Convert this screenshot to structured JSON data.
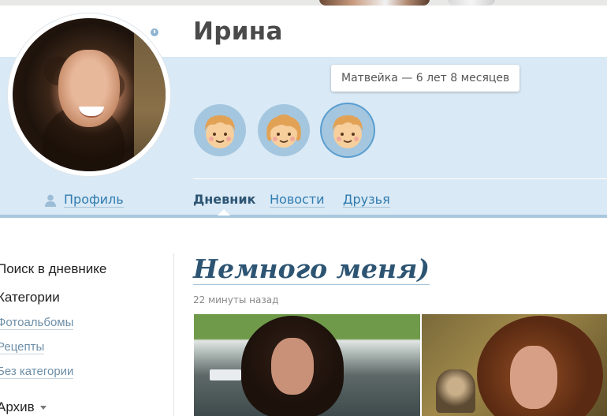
{
  "profile": {
    "name": "Ирина",
    "profile_link": "Профиль"
  },
  "children": {
    "tooltip": "Матвейка — 6 лет 8 месяцев",
    "items": [
      {
        "kind": "boy"
      },
      {
        "kind": "girl"
      },
      {
        "kind": "boy",
        "active": true
      }
    ]
  },
  "tabs": [
    {
      "label": "Дневник",
      "active": true
    },
    {
      "label": "Новости"
    },
    {
      "label": "Друзья"
    }
  ],
  "sidebar": {
    "search": "Поиск в дневнике",
    "categories_title": "Категории",
    "categories": [
      "Фотоальбомы",
      "Рецепты",
      "Без категории"
    ],
    "archive": "Архив"
  },
  "post": {
    "title": "Немного меня)",
    "time": "22 минуты назад"
  },
  "colors": {
    "band": "#d9e9f5",
    "link": "#2f7bb0",
    "title": "#2d5573"
  }
}
